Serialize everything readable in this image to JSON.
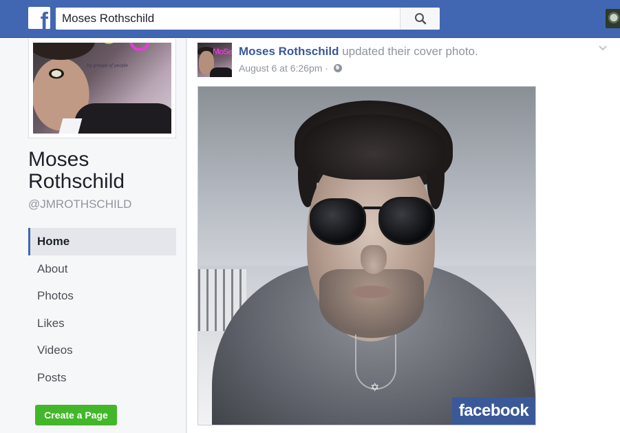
{
  "header": {
    "logo_letter": "f",
    "search_value": "Moses Rothschild"
  },
  "sidebar": {
    "page_name": "Moses Rothschild",
    "handle": "@JMROTHSCHILD",
    "nav_items": [
      "Home",
      "About",
      "Photos",
      "Likes",
      "Videos",
      "Posts"
    ],
    "active_item": "Home",
    "create_page_label": "Create a Page",
    "profile_watermark": "by groups of people"
  },
  "post": {
    "author": "Moses Rothschild",
    "action_text": " updated their cover photo.",
    "timestamp": "August 6 at 6:26pm",
    "meta_separator": " ·",
    "avatar_text": "MoSeS",
    "photo_watermark": "facebook"
  },
  "icons": {
    "search": "search-icon",
    "globe": "globe-icon",
    "chevron": "chevron-down-icon"
  },
  "colors": {
    "brand_blue": "#4267b2",
    "link_blue": "#385898",
    "create_green": "#42b72a",
    "background": "#e9ebee"
  }
}
